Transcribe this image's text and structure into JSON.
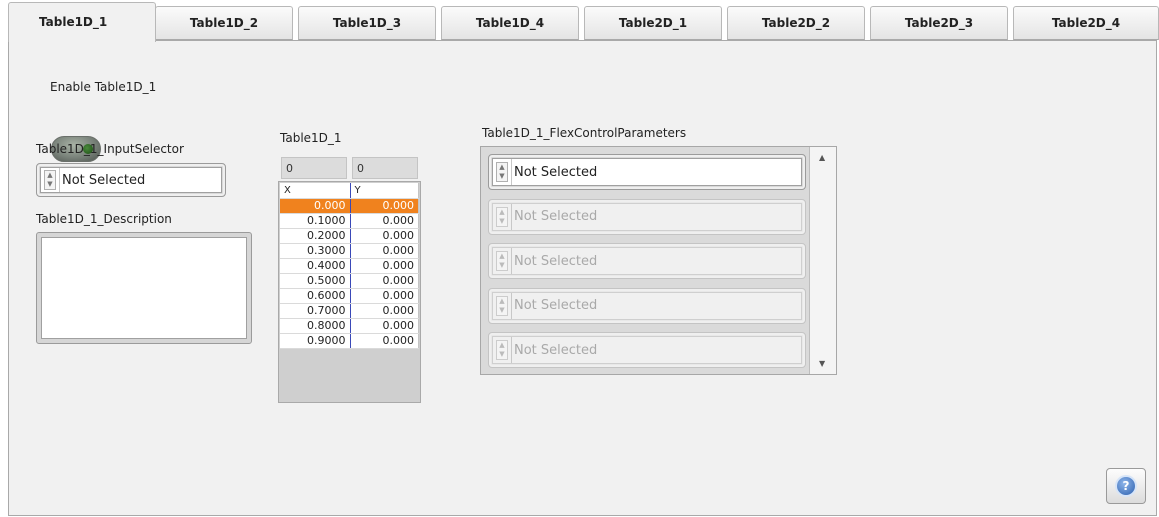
{
  "tabs": [
    {
      "label": "Table1D_1",
      "active": true
    },
    {
      "label": "Table1D_2",
      "active": false
    },
    {
      "label": "Table1D_3",
      "active": false
    },
    {
      "label": "Table1D_4",
      "active": false
    },
    {
      "label": "Table2D_1",
      "active": false
    },
    {
      "label": "Table2D_2",
      "active": false
    },
    {
      "label": "Table2D_3",
      "active": false
    },
    {
      "label": "Table2D_4",
      "active": false
    }
  ],
  "enable": {
    "label": "Enable Table1D_1",
    "state": "off"
  },
  "input_selector": {
    "label": "Table1D_1_InputSelector",
    "value": "Not Selected"
  },
  "description": {
    "label": "Table1D_1_Description",
    "value": ""
  },
  "table": {
    "title": "Table1D_1",
    "index_x": "0",
    "index_y": "0",
    "headers": [
      "X",
      "Y"
    ],
    "selected_row": 0,
    "rows": [
      [
        "0.000",
        "0.000"
      ],
      [
        "0.1000",
        "0.000"
      ],
      [
        "0.2000",
        "0.000"
      ],
      [
        "0.3000",
        "0.000"
      ],
      [
        "0.4000",
        "0.000"
      ],
      [
        "0.5000",
        "0.000"
      ],
      [
        "0.6000",
        "0.000"
      ],
      [
        "0.7000",
        "0.000"
      ],
      [
        "0.8000",
        "0.000"
      ],
      [
        "0.9000",
        "0.000"
      ]
    ]
  },
  "flex": {
    "label": "Table1D_1_FlexControlParameters",
    "items": [
      {
        "value": "Not Selected",
        "enabled": true
      },
      {
        "value": "Not Selected",
        "enabled": false
      },
      {
        "value": "Not Selected",
        "enabled": false
      },
      {
        "value": "Not Selected",
        "enabled": false
      },
      {
        "value": "Not Selected",
        "enabled": false
      }
    ],
    "scroll_up": "▲",
    "scroll_down": "▼"
  },
  "help": {
    "icon": "question-icon",
    "glyph": "?"
  },
  "colors": {
    "selected_cell": "#f0821e",
    "panel": "#f1f1f1",
    "toggle_led": "#2e6b25"
  }
}
